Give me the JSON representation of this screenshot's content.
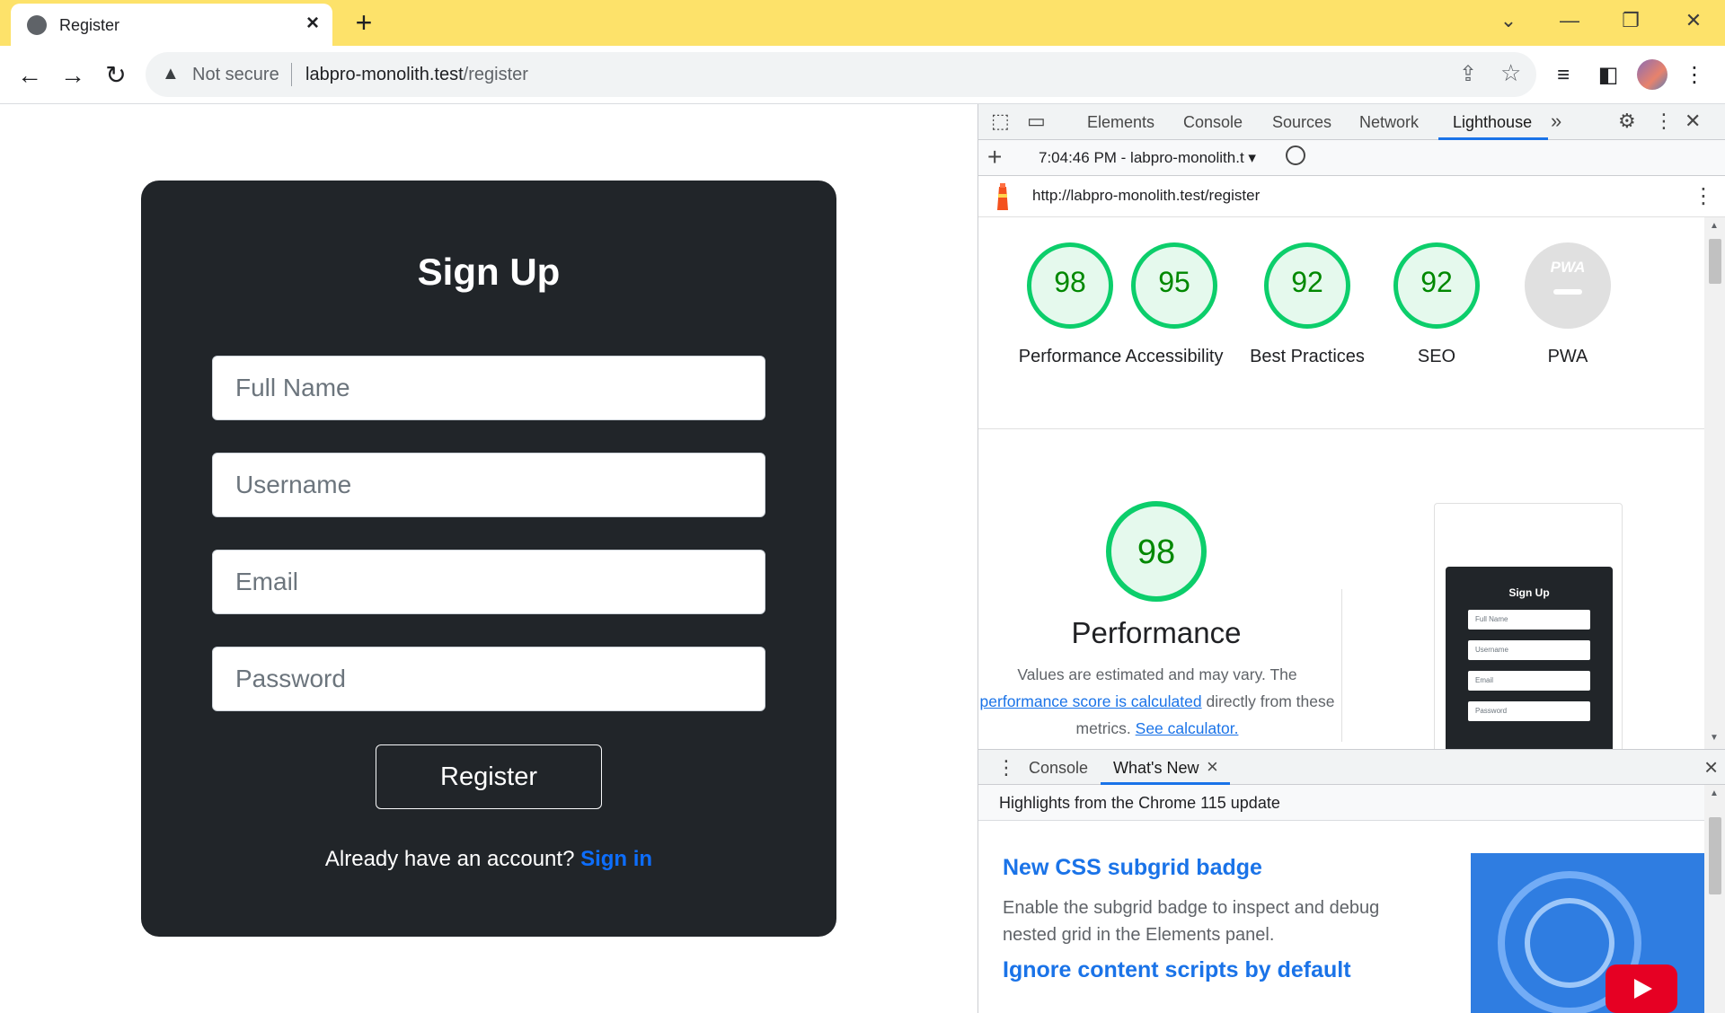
{
  "browser": {
    "tab_title": "Register",
    "new_tab_icon": "plus-icon",
    "security_label": "Not secure",
    "url_host": "labpro-monolith.test",
    "url_path": "/register"
  },
  "form": {
    "title": "Sign Up",
    "full_name_placeholder": "Full Name",
    "username_placeholder": "Username",
    "email_placeholder": "Email",
    "password_placeholder": "Password",
    "register_label": "Register",
    "signin_prompt": "Already have an account?",
    "signin_link": "Sign in",
    "link_color": "#0d6efd",
    "card_color": "#212529"
  },
  "devtools": {
    "tabs": [
      "Elements",
      "Console",
      "Sources",
      "Network",
      "Lighthouse"
    ],
    "active_tab": "Lighthouse",
    "report_selector": "7:04:46 PM - labpro-monolith.t",
    "report_url": "http://labpro-monolith.test/register",
    "scores": [
      {
        "label": "Performance",
        "value": "98"
      },
      {
        "label": "Accessibility",
        "value": "95"
      },
      {
        "label": "Best Practices",
        "value": "92"
      },
      {
        "label": "SEO",
        "value": "92"
      },
      {
        "label": "PWA",
        "value": ""
      }
    ],
    "pwa_badge": "PWA",
    "score_color": "#0cce6b",
    "performance": {
      "score": "98",
      "title": "Performance",
      "desc_pre": "Values are estimated and may vary. The",
      "desc_link": "performance score is calculated",
      "desc_mid": "directly from these metrics.",
      "calc_link": "See calculator."
    },
    "thumbnail": {
      "title": "Sign Up",
      "fields": [
        "Full Name",
        "Username",
        "Email",
        "Password"
      ]
    },
    "drawer": {
      "tab_console": "Console",
      "tab_whats_new": "What's New",
      "header": "Highlights from the Chrome 115 update",
      "items": [
        {
          "heading": "New CSS subgrid badge",
          "text": "Enable the subgrid badge to inspect and debug nested grid in the Elements panel."
        },
        {
          "heading": "Ignore content scripts by default",
          "text": ""
        }
      ]
    }
  }
}
